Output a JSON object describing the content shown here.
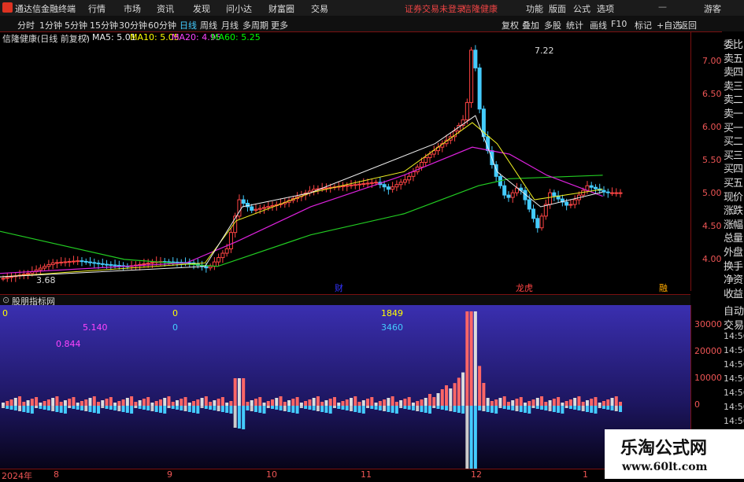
{
  "titlebar": {
    "app": "通达信金融终端",
    "menus": [
      "行情",
      "市场",
      "资讯",
      "发现",
      "问小达",
      "财富圈",
      "交易"
    ],
    "status_warn": "证券交易未登录",
    "stock": "信隆健康",
    "right": [
      "功能",
      "版面",
      "公式",
      "选项"
    ],
    "user": "游客"
  },
  "toolbar": {
    "periods": [
      "分时",
      "1分钟",
      "5分钟",
      "15分钟",
      "30分钟",
      "60分钟",
      "日线",
      "周线",
      "月线",
      "多周期",
      "更多"
    ],
    "active": "日线",
    "buttons": [
      "复权",
      "叠加",
      "多股",
      "统计",
      "画线",
      "F10",
      "标记",
      "+自选",
      "返回"
    ]
  },
  "legend": {
    "name": "信隆健康(日线 前复权)",
    "ma5": "MA5: 5.01",
    "ma10": "MA10: 5.05",
    "ma20": "MA20: 4.95",
    "ma60": "MA60: 5.25"
  },
  "main_annot": {
    "high": "7.22",
    "low": "3.68",
    "tag1": "财",
    "tag2": "龙虎",
    "tag3": "融"
  },
  "yaxis_main": [
    "7.00",
    "6.50",
    "6.00",
    "5.50",
    "5.00",
    "4.50",
    "4.00"
  ],
  "sub": {
    "title": "股朋指标网",
    "v1": "0",
    "v2": "0",
    "v3": "1849",
    "v4": "5.140",
    "v5": "0",
    "v6": "3460",
    "v7": "0.844"
  },
  "yaxis_sub": [
    "30000",
    "20000",
    "10000",
    "0"
  ],
  "right_panel": [
    "委比",
    "卖五",
    "卖四",
    "卖三",
    "卖二",
    "卖一",
    "买一",
    "买二",
    "买三",
    "买四",
    "买五",
    "现价",
    "涨跌",
    "涨幅",
    "总量",
    "外盘",
    "换手",
    "净资",
    "收益"
  ],
  "right_panel2": [
    "自动",
    "交易",
    "14:56",
    "14:56",
    "14:56",
    "14:56",
    "14:56",
    "14:56",
    "14:56",
    "14:56",
    "14:56"
  ],
  "xaxis": [
    "2024年",
    "8",
    "9",
    "10",
    "11",
    "12",
    "1"
  ],
  "watermark": {
    "title": "乐淘公式网",
    "url": "www.60lt.com"
  },
  "chart_data": {
    "type": "candlestick",
    "title": "信隆健康(日线 前复权)",
    "ylim": [
      3.6,
      7.3
    ],
    "high": 7.22,
    "low": 3.68,
    "close_path": [
      [
        0,
        3.78
      ],
      [
        0.04,
        3.85
      ],
      [
        0.08,
        4.0
      ],
      [
        0.12,
        4.03
      ],
      [
        0.16,
        3.98
      ],
      [
        0.2,
        3.95
      ],
      [
        0.25,
        4.02
      ],
      [
        0.3,
        4.0
      ],
      [
        0.33,
        3.92
      ],
      [
        0.36,
        4.2
      ],
      [
        0.38,
        4.9
      ],
      [
        0.4,
        4.75
      ],
      [
        0.45,
        4.85
      ],
      [
        0.5,
        5.05
      ],
      [
        0.55,
        5.1
      ],
      [
        0.6,
        5.15
      ],
      [
        0.62,
        5.05
      ],
      [
        0.65,
        5.2
      ],
      [
        0.68,
        5.5
      ],
      [
        0.72,
        5.8
      ],
      [
        0.745,
        6.1
      ],
      [
        0.755,
        7.22
      ],
      [
        0.77,
        5.9
      ],
      [
        0.79,
        5.3
      ],
      [
        0.81,
        4.9
      ],
      [
        0.83,
        5.1
      ],
      [
        0.86,
        4.5
      ],
      [
        0.88,
        5.0
      ],
      [
        0.91,
        4.8
      ],
      [
        0.94,
        5.1
      ],
      [
        0.97,
        5.0
      ]
    ],
    "ma60_path": [
      [
        0,
        4.45
      ],
      [
        0.2,
        4.05
      ],
      [
        0.35,
        3.95
      ],
      [
        0.5,
        4.4
      ],
      [
        0.65,
        4.7
      ],
      [
        0.77,
        5.1
      ],
      [
        0.82,
        5.2
      ],
      [
        0.97,
        5.25
      ]
    ],
    "ma20_path": [
      [
        0,
        3.85
      ],
      [
        0.3,
        4.0
      ],
      [
        0.38,
        4.3
      ],
      [
        0.5,
        4.8
      ],
      [
        0.65,
        5.25
      ],
      [
        0.76,
        5.65
      ],
      [
        0.82,
        5.55
      ],
      [
        0.88,
        5.25
      ],
      [
        0.97,
        4.95
      ]
    ],
    "ma10_path": [
      [
        0,
        3.8
      ],
      [
        0.33,
        4.0
      ],
      [
        0.38,
        4.6
      ],
      [
        0.5,
        5.0
      ],
      [
        0.65,
        5.3
      ],
      [
        0.76,
        6.0
      ],
      [
        0.8,
        5.7
      ],
      [
        0.86,
        4.9
      ],
      [
        0.97,
        5.05
      ]
    ],
    "ma5_path": [
      [
        0,
        3.8
      ],
      [
        0.33,
        3.95
      ],
      [
        0.39,
        4.8
      ],
      [
        0.5,
        5.0
      ],
      [
        0.7,
        5.7
      ],
      [
        0.765,
        6.1
      ],
      [
        0.8,
        5.3
      ],
      [
        0.87,
        4.8
      ],
      [
        0.97,
        5.01
      ]
    ]
  }
}
